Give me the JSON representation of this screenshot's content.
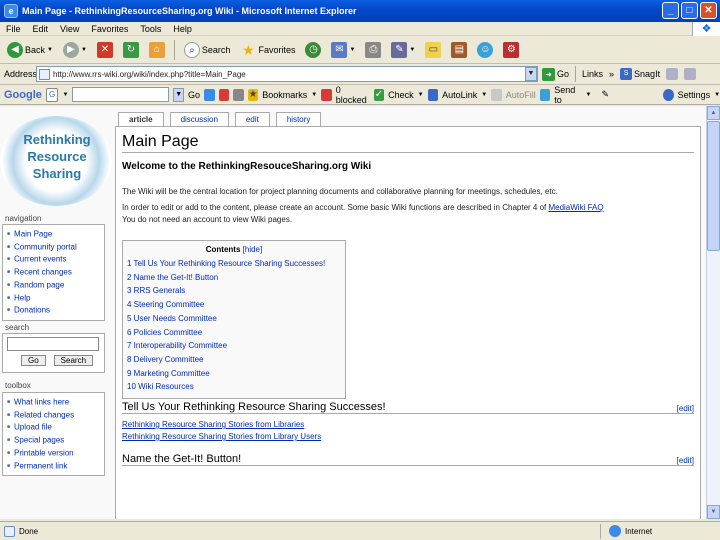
{
  "window": {
    "title": "Main Page - RethinkingResourceSharing.org Wiki - Microsoft Internet Explorer",
    "min": "_",
    "max": "□",
    "close": "✕"
  },
  "menu": [
    "File",
    "Edit",
    "View",
    "Favorites",
    "Tools",
    "Help"
  ],
  "toolbar": {
    "back": "Back",
    "search": "Search",
    "favorites": "Favorites"
  },
  "address": {
    "label": "Address",
    "url": "http://www.rrs-wiki.org/wiki/index.php?title=Main_Page",
    "go": "Go",
    "links": "Links",
    "snagit": "SnagIt"
  },
  "googlebar": {
    "logo": "Google",
    "go": "Go",
    "bookmarks": "Bookmarks",
    "blocked": "0 blocked",
    "check": "Check",
    "autolink": "AutoLink",
    "autofill": "AutoFill",
    "sendto": "Send to",
    "settings": "Settings"
  },
  "logo": {
    "line1": "Rethinking",
    "line2": "Resource",
    "line3": "Sharing"
  },
  "sidebar": {
    "navigation_title": "navigation",
    "navigation": [
      "Main Page",
      "Community portal",
      "Current events",
      "Recent changes",
      "Random page",
      "Help",
      "Donations"
    ],
    "search_title": "search",
    "search_go": "Go",
    "search_btn": "Search",
    "toolbox_title": "toolbox",
    "toolbox": [
      "What links here",
      "Related changes",
      "Upload file",
      "Special pages",
      "Printable version",
      "Permanent link"
    ]
  },
  "tabs": [
    "article",
    "discussion",
    "edit",
    "history"
  ],
  "page": {
    "title": "Main Page",
    "welcome": "Welcome to the RethinkingResouceSharing.org Wiki",
    "para1": "The Wiki will be the central location for project planning documents and collaborative planning for meetings, schedules, etc.",
    "para2a": "In order to edit or add to the content, please create an account. Some basic Wiki functions are described in Chapter 4 of ",
    "para2link": "MediaWiki FAQ",
    "para2b": "You do not need an account to view Wiki pages.",
    "toc_title": "Contents",
    "toc_hide": "[hide]",
    "toc": [
      "1 Tell Us Your Rethinking Resource Sharing Successes!",
      "2 Name the Get-It! Button",
      "3 RRS Generals",
      "4 Steering Committee",
      "5 User Needs Committee",
      "6 Policies Committee",
      "7 Interoperability Committee",
      "8 Delivery Committee",
      "9 Marketing Committee",
      "10 Wiki Resources"
    ],
    "section1": "Tell Us Your Rethinking Resource Sharing Successes!",
    "section1_links": [
      "Rethinking Resource Sharing Stories from Libraries",
      "Rethinking Resource Sharing Stories from Library Users"
    ],
    "section2": "Name the Get-It! Button!",
    "edit": "[edit]"
  },
  "status": {
    "done": "Done",
    "zone": "Internet"
  }
}
